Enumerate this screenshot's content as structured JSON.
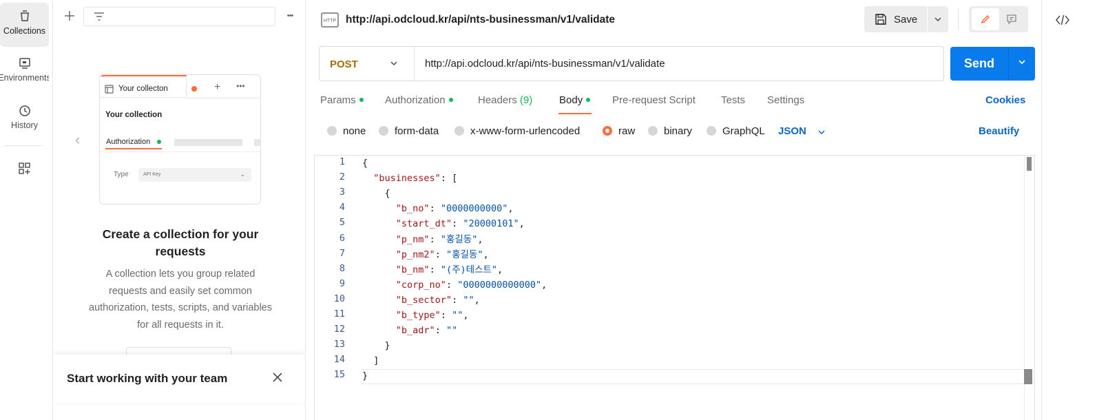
{
  "rail": {
    "items": [
      {
        "label": "Collections",
        "icon": "collections-icon"
      },
      {
        "label": "Environments",
        "icon": "environments-icon"
      },
      {
        "label": "History",
        "icon": "history-icon"
      }
    ],
    "add_icon": "apps-add-icon"
  },
  "sidebar": {
    "more_label": "•••",
    "preview": {
      "tab_label": "Your collecton",
      "plus": "+",
      "more": "•••",
      "title": "Your collection",
      "auth_tab": "Authorization",
      "type_label": "Type",
      "type_value": "API Key"
    },
    "heading": "Create a collection for your requests",
    "description": "A collection lets you group related requests and easily set common authorization, tests, scripts, and variables for all requests in it.",
    "team_banner": "Start working with your team"
  },
  "request": {
    "title": "http://api.odcloud.kr/api/nts-businessman/v1/validate",
    "save_label": "Save",
    "method": "POST",
    "url": "http://api.odcloud.kr/api/nts-businessman/v1/validate",
    "send_label": "Send"
  },
  "tabs": [
    {
      "label": "Params",
      "dot": true
    },
    {
      "label": "Authorization",
      "dot": true
    },
    {
      "label": "Headers",
      "count": "(9)"
    },
    {
      "label": "Body",
      "dot": true,
      "active": true
    },
    {
      "label": "Pre-request Script"
    },
    {
      "label": "Tests"
    },
    {
      "label": "Settings"
    }
  ],
  "cookies_label": "Cookies",
  "body_types": [
    {
      "label": "none"
    },
    {
      "label": "form-data"
    },
    {
      "label": "x-www-form-urlencoded"
    },
    {
      "label": "raw",
      "checked": true
    },
    {
      "label": "binary"
    },
    {
      "label": "GraphQL"
    }
  ],
  "body_format": "JSON",
  "beautify_label": "Beautify",
  "editor": {
    "line_numbers": [
      "1",
      "2",
      "3",
      "4",
      "5",
      "6",
      "7",
      "8",
      "9",
      "10",
      "11",
      "12",
      "13",
      "14",
      "15"
    ],
    "lines": [
      "{",
      "  \"businesses\": [",
      "    {",
      "      \"b_no\": \"0000000000\",",
      "      \"start_dt\": \"20000101\",",
      "      \"p_nm\": \"홍길동\",",
      "      \"p_nm2\": \"홍길동\",",
      "      \"b_nm\": \"(주)테스트\",",
      "      \"corp_no\": \"0000000000000\",",
      "      \"b_sector\": \"\",",
      "      \"b_type\": \"\",",
      "      \"b_adr\": \"\"",
      "    }",
      "  ]",
      "}"
    ]
  },
  "colors": {
    "accent": "#ff6c37",
    "send": "#097bed",
    "link": "#0b66c8",
    "status_dot": "#0cbb52",
    "method": "#ab6a00"
  }
}
